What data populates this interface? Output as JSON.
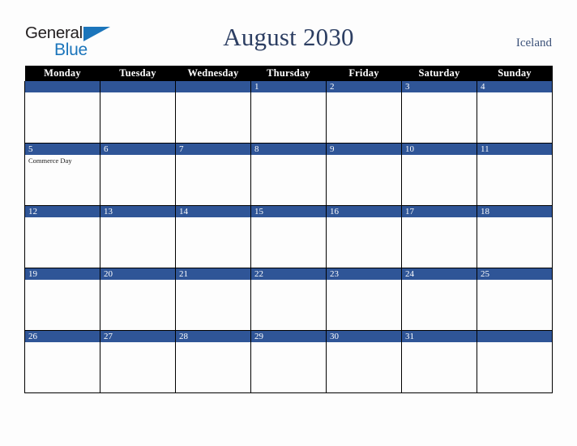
{
  "brand": {
    "logo_word_1": "General",
    "logo_word_2": "Blue",
    "logo_triangle_icon": "blue-triangle-icon",
    "accent_color": "#1b75bb"
  },
  "header": {
    "title": "August 2030",
    "country": "Iceland",
    "title_color": "#2c3e62"
  },
  "colors": {
    "weekday_header_bg": "#000000",
    "weekday_header_text": "#ffffff",
    "day_number_bg": "#2f5597",
    "day_number_text": "#ffffff",
    "cell_bg": "#fdfdfd",
    "grid_line": "#000000",
    "page_bg": "#fdfdfd"
  },
  "weekdays": [
    "Monday",
    "Tuesday",
    "Wednesday",
    "Thursday",
    "Friday",
    "Saturday",
    "Sunday"
  ],
  "weeks": [
    [
      {
        "day": "",
        "events": []
      },
      {
        "day": "",
        "events": []
      },
      {
        "day": "",
        "events": []
      },
      {
        "day": "1",
        "events": []
      },
      {
        "day": "2",
        "events": []
      },
      {
        "day": "3",
        "events": []
      },
      {
        "day": "4",
        "events": []
      }
    ],
    [
      {
        "day": "5",
        "events": [
          "Commerce Day"
        ]
      },
      {
        "day": "6",
        "events": []
      },
      {
        "day": "7",
        "events": []
      },
      {
        "day": "8",
        "events": []
      },
      {
        "day": "9",
        "events": []
      },
      {
        "day": "10",
        "events": []
      },
      {
        "day": "11",
        "events": []
      }
    ],
    [
      {
        "day": "12",
        "events": []
      },
      {
        "day": "13",
        "events": []
      },
      {
        "day": "14",
        "events": []
      },
      {
        "day": "15",
        "events": []
      },
      {
        "day": "16",
        "events": []
      },
      {
        "day": "17",
        "events": []
      },
      {
        "day": "18",
        "events": []
      }
    ],
    [
      {
        "day": "19",
        "events": []
      },
      {
        "day": "20",
        "events": []
      },
      {
        "day": "21",
        "events": []
      },
      {
        "day": "22",
        "events": []
      },
      {
        "day": "23",
        "events": []
      },
      {
        "day": "24",
        "events": []
      },
      {
        "day": "25",
        "events": []
      }
    ],
    [
      {
        "day": "26",
        "events": []
      },
      {
        "day": "27",
        "events": []
      },
      {
        "day": "28",
        "events": []
      },
      {
        "day": "29",
        "events": []
      },
      {
        "day": "30",
        "events": []
      },
      {
        "day": "31",
        "events": []
      },
      {
        "day": "",
        "events": []
      }
    ]
  ]
}
